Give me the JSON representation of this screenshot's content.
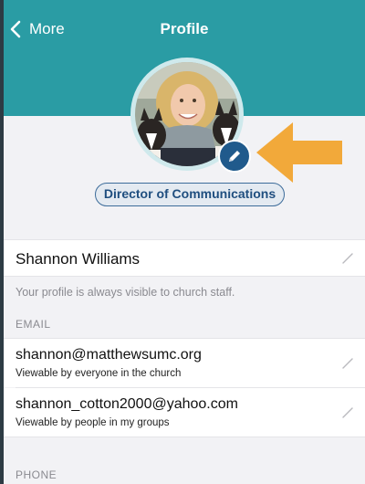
{
  "nav": {
    "back_label": "More",
    "title": "Profile",
    "back_icon": "chevron-left-icon"
  },
  "profile": {
    "role": "Director of Communications",
    "name": "Shannon Williams",
    "visibility_note": "Your profile is always visible to church staff.",
    "edit_photo_icon": "pencil-icon"
  },
  "email": {
    "section_label": "EMAIL",
    "entries": [
      {
        "address": "shannon@matthewsumc.org",
        "visibility": "Viewable by everyone in the church"
      },
      {
        "address": "shannon_cotton2000@yahoo.com",
        "visibility": "Viewable by people in my groups"
      }
    ]
  },
  "phone": {
    "section_label": "PHONE"
  },
  "colors": {
    "header": "#2a9ca4",
    "accent_blue": "#205a8c",
    "annotation_arrow": "#f2a93a",
    "background": "#f2f2f5"
  }
}
